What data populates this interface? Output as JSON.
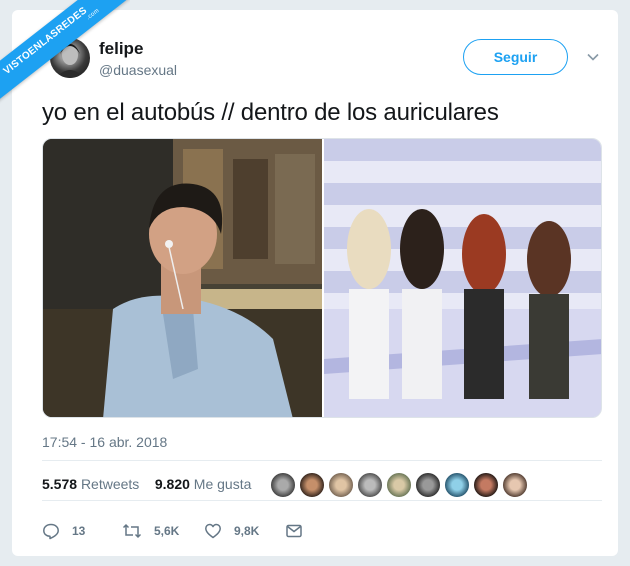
{
  "watermark": {
    "text": "VISTOENLASREDES",
    "sub": ".com"
  },
  "user": {
    "name": "felipe",
    "handle": "@duasexual"
  },
  "follow_label": "Seguir",
  "tweet": {
    "text": "yo en el autobús // dentro de los auriculares",
    "timestamp": "17:54 - 16 abr. 2018"
  },
  "stats": {
    "retweets_count": "5.578",
    "retweets_label": "Retweets",
    "likes_count": "9.820",
    "likes_label": "Me gusta"
  },
  "actions": {
    "replies": "13",
    "retweets": "5,6K",
    "likes": "9,8K"
  },
  "icons": [
    "avatar",
    "chevron-down-icon",
    "reply-icon",
    "retweet-icon",
    "heart-icon",
    "message-icon"
  ],
  "colors": {
    "accent": "#1da1f2",
    "muted": "#657786",
    "text": "#14171a",
    "background": "#e6ecf0"
  }
}
